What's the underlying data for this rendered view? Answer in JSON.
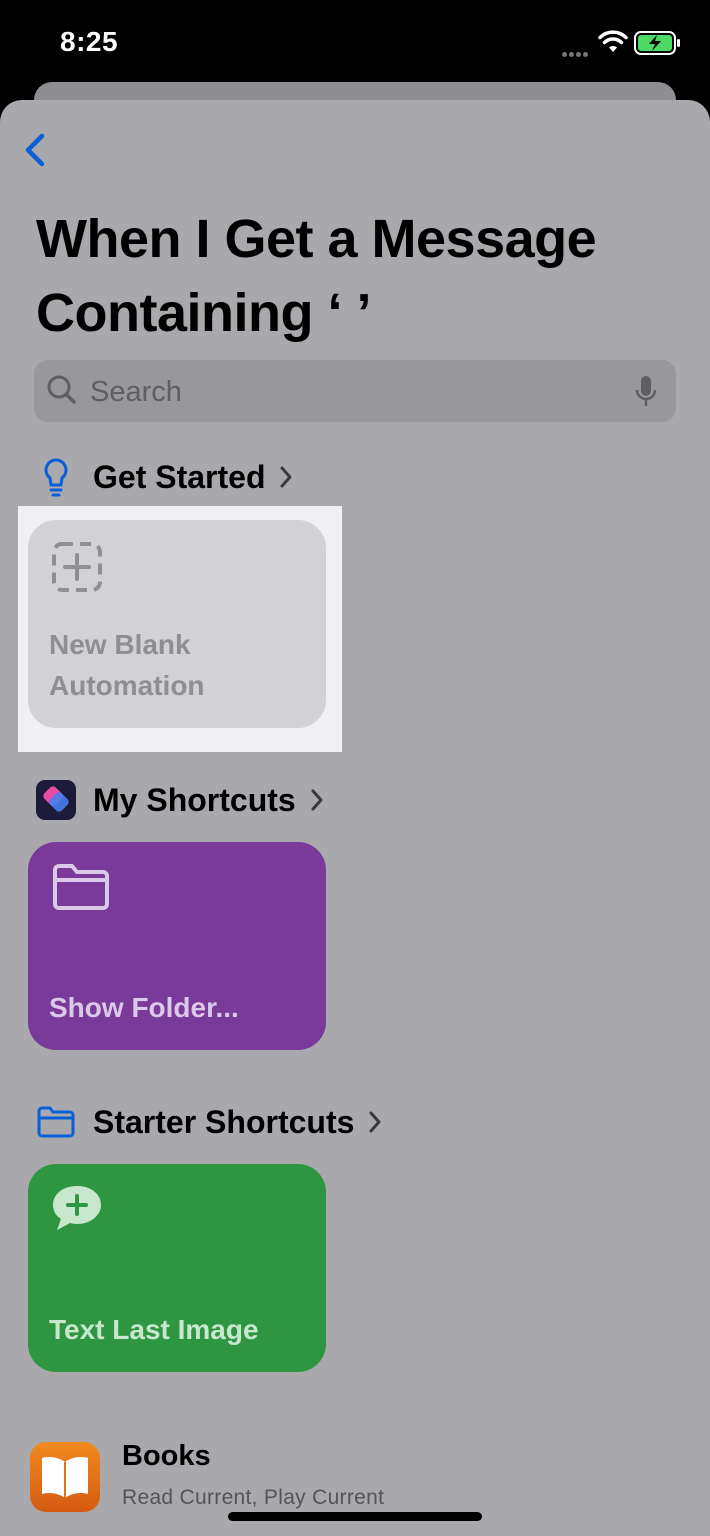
{
  "status_bar": {
    "time": "8:25"
  },
  "header": {
    "title_line1": "When I Get a Message",
    "title_line2": "Containing ‘ ’"
  },
  "search": {
    "placeholder": "Search"
  },
  "sections": {
    "get_started": {
      "label": "Get Started"
    },
    "my_shortcuts": {
      "label": "My Shortcuts"
    },
    "starter_shortcuts": {
      "label": "Starter Shortcuts"
    }
  },
  "cards": {
    "new_blank": {
      "label": "New Blank Automation",
      "icon": "dashed-plus-square-icon"
    },
    "show_folder": {
      "label": "Show Folder...",
      "icon": "folder-icon",
      "color": "#7a3a9a"
    },
    "text_last_image": {
      "label": "Text Last Image",
      "icon": "message-plus-icon",
      "color": "#2e9640"
    }
  },
  "apps": {
    "books": {
      "title": "Books",
      "subtitle": "Read Current, Play Current",
      "icon": "book-icon"
    }
  },
  "colors": {
    "accent": "#0a5fd8",
    "sheet_bg": "#a8a8ad"
  }
}
